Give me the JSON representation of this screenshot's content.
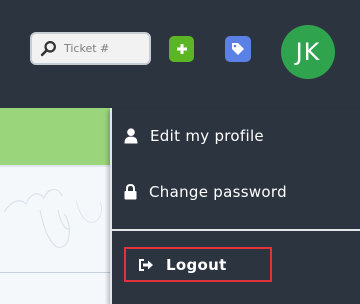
{
  "header": {
    "search": {
      "placeholder": "Ticket #",
      "value": ""
    },
    "avatar_initials": "JK"
  },
  "user_menu": {
    "items": [
      {
        "label": "Edit my profile",
        "icon": "user-icon"
      },
      {
        "label": "Change password",
        "icon": "lock-icon"
      }
    ],
    "logout": {
      "label": "Logout",
      "icon": "sign-out-icon",
      "highlight_color": "#e2323b"
    }
  },
  "colors": {
    "header_bg": "#2c3440",
    "add_button": "#5cb524",
    "tag_button": "#5b80e6",
    "avatar_bg": "#2fa34e",
    "green_band": "#9bd57b"
  }
}
